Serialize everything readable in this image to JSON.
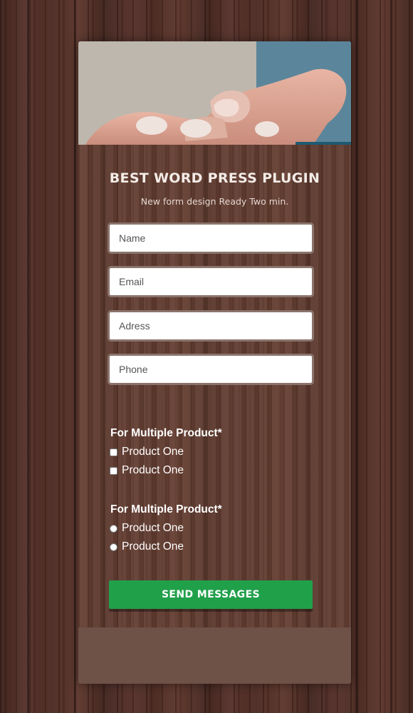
{
  "form": {
    "title": "BEST WORD PRESS PLUGIN",
    "subtitle": "New form design Ready Two min.",
    "fields": {
      "name_placeholder": "Name",
      "email_placeholder": "Email",
      "address_placeholder": "Adress",
      "phone_placeholder": "Phone"
    },
    "checkbox_group": {
      "label": "For Multiple Product*",
      "options": [
        "Product One",
        "Product One"
      ]
    },
    "radio_group": {
      "label": "For Multiple Product*",
      "options": [
        "Product One",
        "Product One"
      ]
    },
    "submit_label": "SEND MESSAGES"
  },
  "colors": {
    "submit_button": "#21a04a",
    "title_text": "#f3ece7",
    "footer_panel": "#6e5147"
  },
  "images": {
    "hero": "photo of a hand with fingertips (header image)"
  }
}
